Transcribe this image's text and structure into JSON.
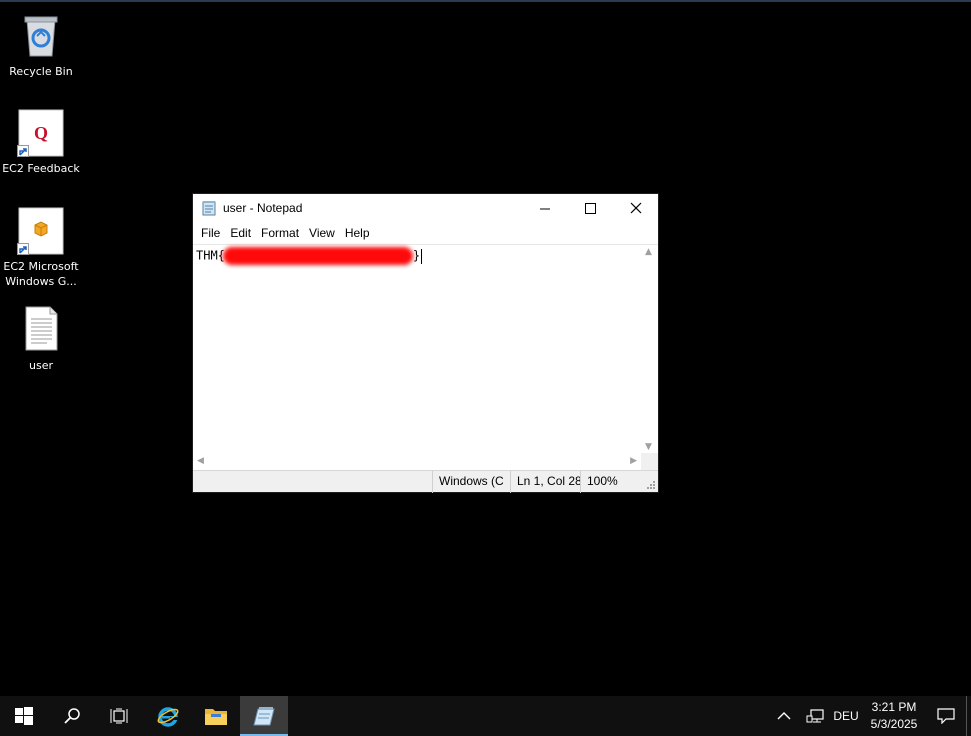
{
  "desktop": {
    "icons": [
      {
        "label": "Recycle Bin",
        "icon": "recycle-bin-icon"
      },
      {
        "label": "EC2 Feedback",
        "icon": "ec2-feedback-icon"
      },
      {
        "label": "EC2 Microsoft Windows G...",
        "icon": "ec2-windows-guide-icon"
      },
      {
        "label": "user",
        "icon": "text-file-icon"
      }
    ]
  },
  "notepad": {
    "title": "user - Notepad",
    "menu": [
      "File",
      "Edit",
      "Format",
      "View",
      "Help"
    ],
    "content_prefix": "THM{",
    "content_suffix": "}",
    "status": {
      "encoding": "Windows (C",
      "position": "Ln 1, Col 28",
      "zoom": "100%"
    }
  },
  "taskbar": {
    "items": [
      "start-icon",
      "search-icon",
      "task-view-icon",
      "internet-explorer-icon",
      "file-explorer-icon",
      "notepad-icon"
    ],
    "active_item": "notepad-icon",
    "tray": {
      "language": "DEU",
      "time": "3:21 PM",
      "date": "5/3/2025"
    }
  },
  "colors": {
    "desktop_bg": "#000000",
    "taskbar_bg": "#101010",
    "redaction": "#ff0a0a",
    "accent": "#76b9ed"
  }
}
